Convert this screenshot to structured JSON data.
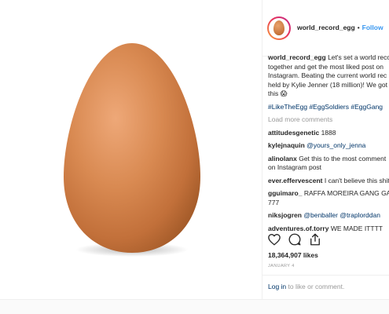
{
  "post": {
    "username": "world_record_egg",
    "follow_label": "Follow",
    "separator": "•",
    "caption": {
      "author": "world_record_egg",
      "lines": [
        "Let's set a world reco",
        "together and get the most liked post on",
        "Instagram. Beating the current world rec",
        "held by Kylie Jenner (18 million)! We got",
        "this 😱"
      ],
      "hashtags": "#LikeTheEgg #EggSoldiers #EggGang"
    },
    "load_more": "Load more comments",
    "comments": [
      {
        "user": "attitudesgenetic",
        "lines": [
          "1888"
        ]
      },
      {
        "user": "kylejnaquin",
        "mention": "@yours_only_jenna",
        "lines": [
          ""
        ]
      },
      {
        "user": "alinolanx",
        "lines": [
          "Get this to the most comment",
          "on Instagram post"
        ]
      },
      {
        "user": "ever.effervescent",
        "lines": [
          "I can't believe this shit"
        ]
      },
      {
        "user": "gguimaro_",
        "lines": [
          "RAFFA MOREIRA GANG GAN",
          "777"
        ]
      },
      {
        "user": "niksjogren",
        "mention": "@benballer @traplorddan",
        "lines": [
          ""
        ]
      },
      {
        "user": "adventures.of.torry",
        "lines": [
          "WE MADE ITTTT"
        ]
      }
    ],
    "likes": "18,364,907 likes",
    "date": "JANUARY 4",
    "login_link": "Log in",
    "login_suffix": " to like or comment.",
    "icons": [
      "heart-icon",
      "comment-icon",
      "share-icon"
    ],
    "colors": {
      "link_blue": "#3897f0",
      "tag_blue": "#003569",
      "muted": "#999999",
      "text": "#262626"
    }
  }
}
